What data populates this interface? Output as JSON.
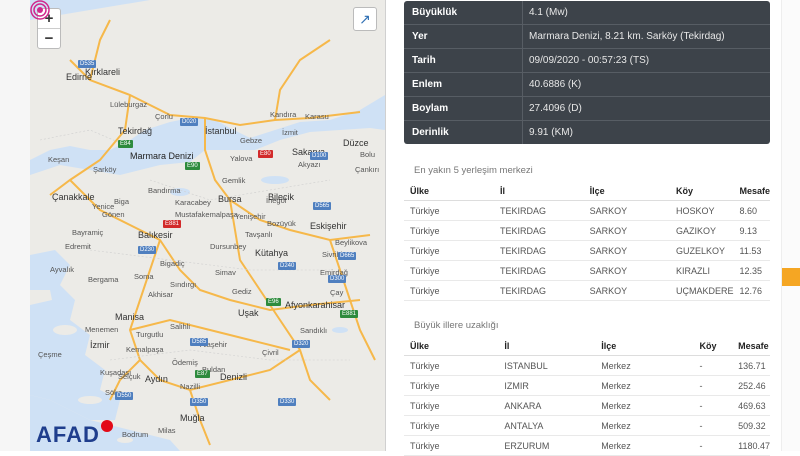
{
  "map": {
    "zoom_in_label": "+",
    "zoom_out_label": "−",
    "fullscreen_icon": "↗",
    "sea_label": "Marmara Denizi",
    "logo_text": "AFAD",
    "labels": [
      "Kırklareli",
      "Edirne",
      "Lüleburgaz",
      "Çorlu",
      "Tekirdağ",
      "Keşan",
      "İstanbul",
      "Gebze",
      "İzmit",
      "Sakarya",
      "Düzce",
      "Yalova",
      "Bursa",
      "Gemlik",
      "Şarköy",
      "Çanakkale",
      "Biga",
      "Bandırma",
      "Mustafakemalpaşa",
      "İnegöl",
      "Bilecik",
      "Bozüyük",
      "Eskişehir",
      "Balıkesir",
      "Bigadiç",
      "Dursunbey",
      "Kütahya",
      "Edremit",
      "Ayvalık",
      "Bergama",
      "Soma",
      "Akhisar",
      "Simav",
      "Gediz",
      "Uşak",
      "Manisa",
      "Salihli",
      "Turgutlu",
      "Afyonkarahisar",
      "İzmir",
      "Çeşme",
      "Aydın",
      "Denizli",
      "Nazilli",
      "Söke",
      "Muğla",
      "Bodrum",
      "Kuşadası",
      "Sandıklı",
      "Çivril",
      "Tavşanlı",
      "Emirdağ",
      "Bolu",
      "Beylikova",
      "Sivrihisar",
      "Çay",
      "Alaşehir",
      "Milas",
      "Selçuk",
      "Menemen",
      "Ödemiş",
      "Sındırgı",
      "Gönen",
      "Karacabey",
      "Bayramiç",
      "Yenice",
      "Kemalpaşa",
      "Buldan",
      "Akyazı",
      "Çankırı",
      "Yenişehir",
      "Kandıra",
      "Karasu"
    ],
    "shields": [
      "D535",
      "E80",
      "D020",
      "D100",
      "E90",
      "E84",
      "E881",
      "D230",
      "D240",
      "D565",
      "D665",
      "E96",
      "D300",
      "E87",
      "D330",
      "D320",
      "D550",
      "D585",
      "D350",
      "E881"
    ]
  },
  "info": {
    "rows": [
      {
        "key": "Büyüklük",
        "value": "4.1 (Mw)"
      },
      {
        "key": "Yer",
        "value": "Marmara Denizi, 8.21 km. Sarköy (Tekirdag)"
      },
      {
        "key": "Tarih",
        "value": "09/09/2020 - 00:57:23 (TS)"
      },
      {
        "key": "Enlem",
        "value": "40.6886 (K)"
      },
      {
        "key": "Boylam",
        "value": "27.4096 (D)"
      },
      {
        "key": "Derinlik",
        "value": "9.91 (KM)"
      }
    ]
  },
  "nearest": {
    "title": "En yakın 5 yerleşim merkezi",
    "headers": [
      "Ülke",
      "İl",
      "İlçe",
      "Köy",
      "Mesafe"
    ],
    "rows": [
      [
        "Türkiye",
        "TEKIRDAG",
        "SARKOY",
        "HOSKOY",
        "8.60"
      ],
      [
        "Türkiye",
        "TEKIRDAG",
        "SARKOY",
        "GAZIKOY",
        "9.13"
      ],
      [
        "Türkiye",
        "TEKIRDAG",
        "SARKOY",
        "GUZELKOY",
        "11.53"
      ],
      [
        "Türkiye",
        "TEKIRDAG",
        "SARKOY",
        "KIRAZLI",
        "12.35"
      ],
      [
        "Türkiye",
        "TEKIRDAG",
        "SARKOY",
        "UÇMAKDERE",
        "12.76"
      ]
    ]
  },
  "cities": {
    "title": "Büyük illere uzaklığı",
    "headers": [
      "Ülke",
      "İl",
      "İlçe",
      "Köy",
      "Mesafe"
    ],
    "rows": [
      [
        "Türkiye",
        "ISTANBUL",
        "Merkez",
        "-",
        "136.71"
      ],
      [
        "Türkiye",
        "IZMIR",
        "Merkez",
        "-",
        "252.46"
      ],
      [
        "Türkiye",
        "ANKARA",
        "Merkez",
        "-",
        "469.63"
      ],
      [
        "Türkiye",
        "ANTALYA",
        "Merkez",
        "-",
        "509.32"
      ],
      [
        "Türkiye",
        "ERZURUM",
        "Merkez",
        "-",
        "1180.47"
      ]
    ]
  }
}
